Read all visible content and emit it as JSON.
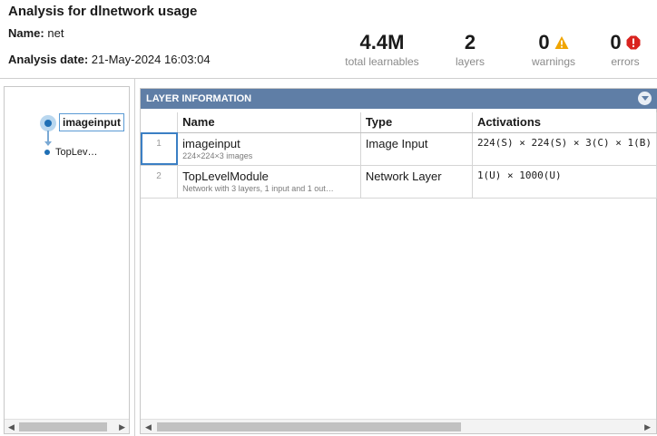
{
  "header": {
    "title": "Analysis for dlnetwork usage",
    "name_label": "Name:",
    "name_value": "net",
    "date_label": "Analysis date:",
    "date_value": "21-May-2024 16:03:04"
  },
  "stats": {
    "learnables": {
      "value": "4.4M",
      "label": "total learnables"
    },
    "layers": {
      "value": "2",
      "label": "layers"
    },
    "warnings": {
      "value": "0",
      "label": "warnings",
      "icon": "warning-icon",
      "color": "#f0a500"
    },
    "errors": {
      "value": "0",
      "label": "errors",
      "icon": "error-icon",
      "color": "#d9231f"
    }
  },
  "graph": {
    "nodes": [
      {
        "label": "imageinput",
        "selected": true
      },
      {
        "label": "TopLev…",
        "selected": false
      }
    ]
  },
  "layer_panel": {
    "title": "LAYER INFORMATION",
    "columns": [
      "",
      "Name",
      "Type",
      "Activations"
    ],
    "rows": [
      {
        "index": "1",
        "name": "imageinput",
        "desc": "224×224×3 images",
        "type": "Image Input",
        "activations": "224(S) × 224(S) × 3(C) × 1(B)"
      },
      {
        "index": "2",
        "name": "TopLevelModule",
        "desc": "Network with 3 layers, 1 input and 1 out…",
        "type": "Network Layer",
        "activations": "1(U) × 1000(U)"
      }
    ]
  },
  "colors": {
    "panel_header": "#5f7ea6",
    "selection": "#3b7fc4",
    "node": "#1f6fb5"
  }
}
